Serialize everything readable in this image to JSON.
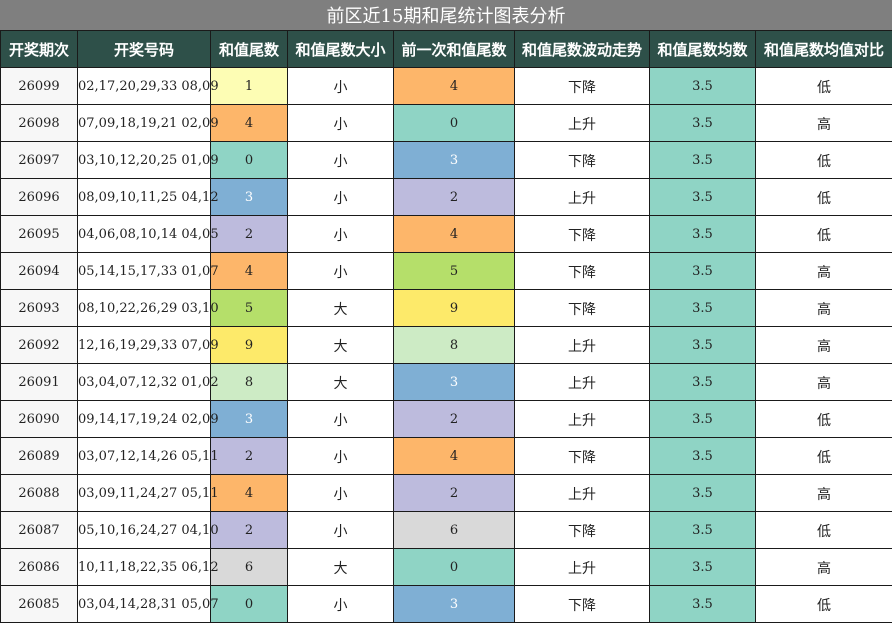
{
  "title": "前区近15期和尾统计图表分析",
  "headers": [
    "开奖期次",
    "开奖号码",
    "和值尾数",
    "和值尾数大小",
    "前一次和值尾数",
    "和值尾数波动走势",
    "和值尾数均数",
    "和值尾数均值对比"
  ],
  "digit_colors": {
    "0": "#8fd4c5",
    "1": "#fdfdb4",
    "2": "#bdbbdd",
    "3": "#7fafd4",
    "4": "#fdb66a",
    "5": "#b5df6a",
    "6": "#d9d9d9",
    "8": "#cdebc5",
    "9": "#fdea6a"
  },
  "rows": [
    {
      "period": "26099",
      "numbers": "02,17,20,29,33 08,09",
      "tail": "1",
      "size": "小",
      "prev": "4",
      "trend": "下降",
      "avg": "3.5",
      "compare": "低"
    },
    {
      "period": "26098",
      "numbers": "07,09,18,19,21 02,09",
      "tail": "4",
      "size": "小",
      "prev": "0",
      "trend": "上升",
      "avg": "3.5",
      "compare": "高"
    },
    {
      "period": "26097",
      "numbers": "03,10,12,20,25 01,09",
      "tail": "0",
      "size": "小",
      "prev": "3",
      "trend": "下降",
      "avg": "3.5",
      "compare": "低"
    },
    {
      "period": "26096",
      "numbers": "08,09,10,11,25 04,12",
      "tail": "3",
      "size": "小",
      "prev": "2",
      "trend": "上升",
      "avg": "3.5",
      "compare": "低"
    },
    {
      "period": "26095",
      "numbers": "04,06,08,10,14 04,05",
      "tail": "2",
      "size": "小",
      "prev": "4",
      "trend": "下降",
      "avg": "3.5",
      "compare": "低"
    },
    {
      "period": "26094",
      "numbers": "05,14,15,17,33 01,07",
      "tail": "4",
      "size": "小",
      "prev": "5",
      "trend": "下降",
      "avg": "3.5",
      "compare": "高"
    },
    {
      "period": "26093",
      "numbers": "08,10,22,26,29 03,10",
      "tail": "5",
      "size": "大",
      "prev": "9",
      "trend": "下降",
      "avg": "3.5",
      "compare": "高"
    },
    {
      "period": "26092",
      "numbers": "12,16,19,29,33 07,09",
      "tail": "9",
      "size": "大",
      "prev": "8",
      "trend": "上升",
      "avg": "3.5",
      "compare": "高"
    },
    {
      "period": "26091",
      "numbers": "03,04,07,12,32 01,02",
      "tail": "8",
      "size": "大",
      "prev": "3",
      "trend": "上升",
      "avg": "3.5",
      "compare": "高"
    },
    {
      "period": "26090",
      "numbers": "09,14,17,19,24 02,09",
      "tail": "3",
      "size": "小",
      "prev": "2",
      "trend": "上升",
      "avg": "3.5",
      "compare": "低"
    },
    {
      "period": "26089",
      "numbers": "03,07,12,14,26 05,11",
      "tail": "2",
      "size": "小",
      "prev": "4",
      "trend": "下降",
      "avg": "3.5",
      "compare": "低"
    },
    {
      "period": "26088",
      "numbers": "03,09,11,24,27 05,11",
      "tail": "4",
      "size": "小",
      "prev": "2",
      "trend": "上升",
      "avg": "3.5",
      "compare": "高"
    },
    {
      "period": "26087",
      "numbers": "05,10,16,24,27 04,10",
      "tail": "2",
      "size": "小",
      "prev": "6",
      "trend": "下降",
      "avg": "3.5",
      "compare": "低"
    },
    {
      "period": "26086",
      "numbers": "10,11,18,22,35 06,12",
      "tail": "6",
      "size": "大",
      "prev": "0",
      "trend": "上升",
      "avg": "3.5",
      "compare": "高"
    },
    {
      "period": "26085",
      "numbers": "03,04,14,28,31 05,07",
      "tail": "0",
      "size": "小",
      "prev": "3",
      "trend": "下降",
      "avg": "3.5",
      "compare": "低"
    }
  ]
}
